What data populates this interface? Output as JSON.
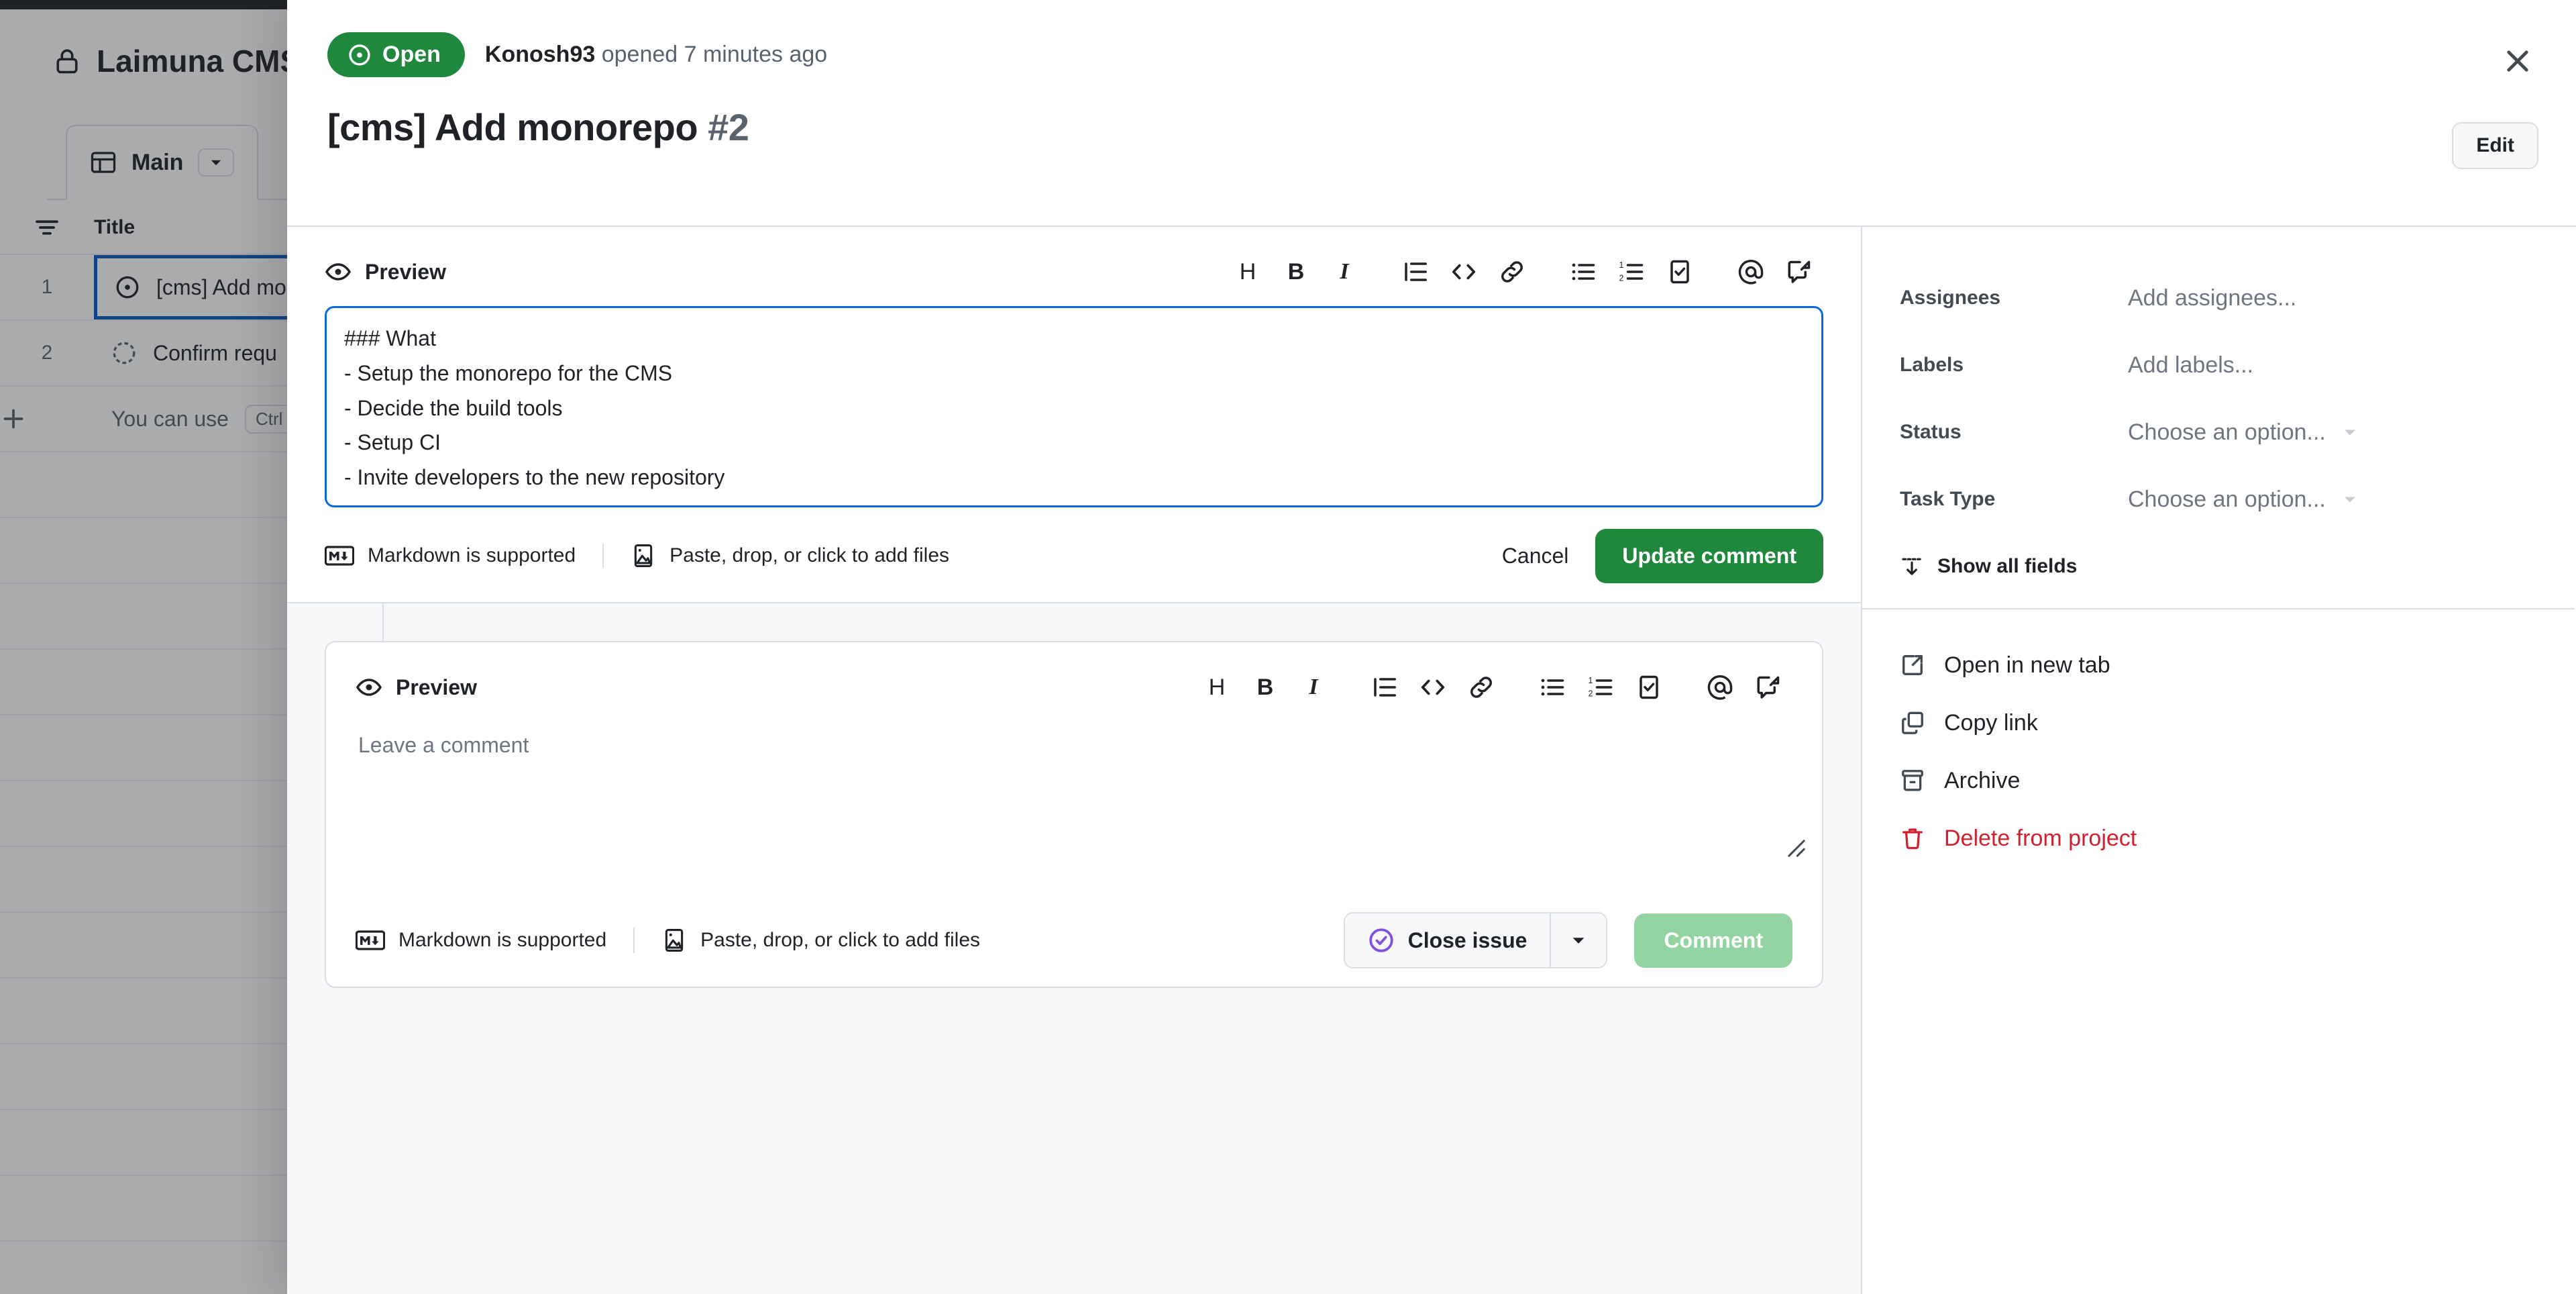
{
  "background": {
    "project_title": "Laimuna CMS",
    "lock_icon": "lock-icon",
    "tab": {
      "label": "Main",
      "icon": "table-view-icon",
      "caret_icon": "chevron-down-icon"
    },
    "table": {
      "filter_icon": "filter-icon",
      "columns": [
        "Title"
      ],
      "rows": [
        {
          "num": "1",
          "status_icon": "issue-open-icon",
          "title": "[cms] Add monorepo"
        },
        {
          "num": "2",
          "status_icon": "issue-draft-icon",
          "title": "Confirm requ"
        }
      ],
      "add_row": {
        "icon": "plus-icon",
        "text": "You can use",
        "kbd": "Ctrl"
      }
    }
  },
  "modal": {
    "close_icon": "close-icon",
    "state": {
      "label": "Open",
      "icon": "issue-open-icon",
      "color": "#1f883d"
    },
    "meta": {
      "author": "Konosh93",
      "action": "opened 7 minutes ago"
    },
    "title": "[cms] Add monorepo",
    "number": "#2",
    "edit_button": "Edit"
  },
  "editor_toolbar": {
    "preview_label": "Preview",
    "preview_icon": "eye-icon",
    "buttons": [
      {
        "name": "heading-icon",
        "glyph": "H"
      },
      {
        "name": "bold-icon",
        "glyph": "B"
      },
      {
        "name": "italic-icon",
        "glyph": "I"
      },
      {
        "name": "quote-icon",
        "glyph": ""
      },
      {
        "name": "code-icon",
        "glyph": "<>"
      },
      {
        "name": "link-icon",
        "glyph": ""
      },
      {
        "name": "unordered-list-icon",
        "glyph": ""
      },
      {
        "name": "ordered-list-icon",
        "glyph": ""
      },
      {
        "name": "task-list-icon",
        "glyph": ""
      },
      {
        "name": "mention-icon",
        "glyph": "@"
      },
      {
        "name": "reference-icon",
        "glyph": ""
      }
    ]
  },
  "edit_composer": {
    "body_value": "### What\n- Setup the monorepo for the CMS\n- Decide the build tools\n- Setup CI\n- Invite developers to the new repository",
    "markdown_hint": "Markdown is supported",
    "markdown_icon": "markdown-icon",
    "attach_hint": "Paste, drop, or click to add files",
    "attach_icon": "image-icon",
    "cancel_label": "Cancel",
    "submit_label": "Update comment"
  },
  "reply_composer": {
    "placeholder": "Leave a comment",
    "value": "",
    "markdown_hint": "Markdown is supported",
    "markdown_icon": "markdown-icon",
    "attach_hint": "Paste, drop, or click to add files",
    "attach_icon": "image-icon",
    "close_issue_label": "Close issue",
    "close_issue_icon": "issue-closed-check-icon",
    "close_caret_icon": "chevron-down-icon",
    "comment_label": "Comment",
    "resize_icon": "resize-grip-icon"
  },
  "sidebar": {
    "fields": [
      {
        "label": "Assignees",
        "value": "Add assignees...",
        "has_caret": false
      },
      {
        "label": "Labels",
        "value": "Add labels...",
        "has_caret": false
      },
      {
        "label": "Status",
        "value": "Choose an option...",
        "has_caret": true
      },
      {
        "label": "Task Type",
        "value": "Choose an option...",
        "has_caret": true
      }
    ],
    "show_all_fields": "Show all fields",
    "show_all_fields_icon": "fold-down-icon",
    "actions": [
      {
        "label": "Open in new tab",
        "icon": "external-link-icon",
        "danger": false
      },
      {
        "label": "Copy link",
        "icon": "copy-icon",
        "danger": false
      },
      {
        "label": "Archive",
        "icon": "archive-icon",
        "danger": false
      },
      {
        "label": "Delete from project",
        "icon": "trash-icon",
        "danger": true
      }
    ]
  },
  "colors": {
    "open_green": "#1f883d",
    "danger_red": "#cf222e",
    "focus_blue": "#0969da",
    "selected_blue": "#0b57c2",
    "purple": "#8250df"
  }
}
